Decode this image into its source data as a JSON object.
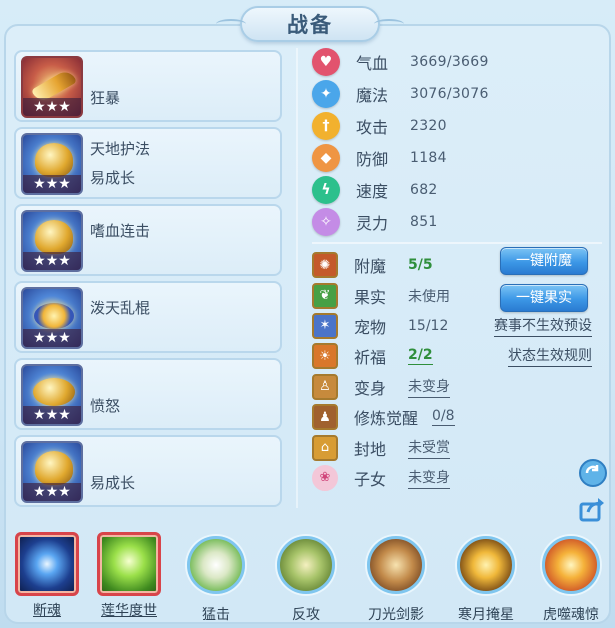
{
  "window": {
    "title": "战备"
  },
  "equipment": [
    {
      "lines": [
        "狂暴"
      ],
      "stars": "★★★",
      "icon": "sword-gem-icon"
    },
    {
      "lines": [
        "天地护法",
        "易成长"
      ],
      "stars": "★★★",
      "icon": "helmet-icon"
    },
    {
      "lines": [
        "嗜血连击"
      ],
      "stars": "★★★",
      "icon": "armor-icon"
    },
    {
      "lines": [
        "泼天乱棍"
      ],
      "stars": "★★★",
      "icon": "necklace-icon"
    },
    {
      "lines": [
        "愤怒"
      ],
      "stars": "★★★",
      "icon": "belt-icon"
    },
    {
      "lines": [
        "易成长"
      ],
      "stars": "★★★",
      "icon": "boots-icon"
    }
  ],
  "stats": [
    {
      "label": "气血",
      "value": "3669/3669",
      "icon": "heart-icon",
      "color": "#e2536e"
    },
    {
      "label": "魔法",
      "value": "3076/3076",
      "icon": "mana-icon",
      "color": "#4aa6ea"
    },
    {
      "label": "攻击",
      "value": "2320",
      "icon": "sword-icon",
      "color": "#f2b12e"
    },
    {
      "label": "防御",
      "value": "1184",
      "icon": "shield-icon",
      "color": "#ef9543"
    },
    {
      "label": "速度",
      "value": "682",
      "icon": "lightning-icon",
      "color": "#2cc08c"
    },
    {
      "label": "灵力",
      "value": "851",
      "icon": "spirit-icon",
      "color": "#c48ce6"
    }
  ],
  "attributes": [
    {
      "label": "附魔",
      "value": "5/5",
      "green": true,
      "underline": false,
      "icon": "enchant-icon",
      "color": "#c45a2a"
    },
    {
      "label": "果实",
      "value": "未使用",
      "green": false,
      "underline": false,
      "icon": "fruit-icon",
      "color": "#47a045"
    },
    {
      "label": "宠物",
      "value": "15/12",
      "green": false,
      "underline": false,
      "icon": "pet-icon",
      "color": "#4b74c9"
    },
    {
      "label": "祈福",
      "value": "2/2",
      "green": true,
      "underline": true,
      "icon": "blessing-icon",
      "color": "#d9772b"
    },
    {
      "label": "变身",
      "value": "未变身",
      "green": false,
      "underline": true,
      "icon": "transform-icon",
      "color": "#c78a3c"
    },
    {
      "label": "修炼觉醒",
      "value": "0/8",
      "green": false,
      "underline": true,
      "icon": "cultivation-icon",
      "color": "#a0612e"
    },
    {
      "label": "封地",
      "value": "未受赏",
      "green": false,
      "underline": true,
      "icon": "fief-icon",
      "color": "#d89c34"
    },
    {
      "label": "子女",
      "value": "未变身",
      "green": false,
      "underline": true,
      "icon": "lotus-icon",
      "color": "#e47aa3"
    }
  ],
  "buttons": {
    "enchant_all": "一键附魔",
    "fruit_all": "一键果实"
  },
  "links": {
    "event_preset": "赛事不生效预设",
    "status_rules": "状态生效规则"
  },
  "skills": [
    {
      "name": "断魂",
      "style": "square",
      "underline": true,
      "icon": "soul-orb-icon"
    },
    {
      "name": "莲华度世",
      "style": "square",
      "underline": true,
      "icon": "lotus-hand-icon"
    },
    {
      "name": "猛击",
      "style": "round",
      "underline": false,
      "icon": "fist-icon"
    },
    {
      "name": "反攻",
      "style": "round",
      "underline": false,
      "icon": "counter-icon"
    },
    {
      "name": "刀光剑影",
      "style": "round",
      "underline": false,
      "icon": "blade-icon"
    },
    {
      "name": "寒月掩星",
      "style": "round",
      "underline": false,
      "icon": "moon-icon"
    },
    {
      "name": "虎噬魂惊",
      "style": "round",
      "underline": false,
      "icon": "tiger-icon"
    }
  ]
}
